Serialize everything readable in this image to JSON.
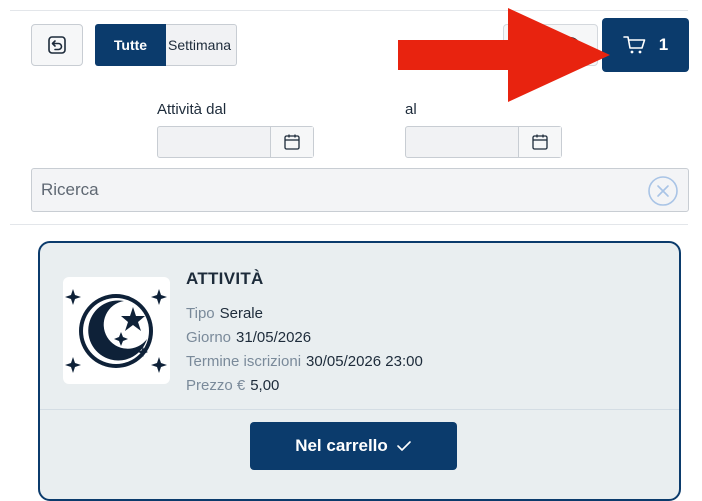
{
  "toolbar": {
    "back_icon": "back-icon",
    "segment": {
      "all_label": "Tutte",
      "week_label": "Settimana"
    },
    "cart": {
      "icon": "cart-icon",
      "count": "1"
    }
  },
  "filters": {
    "from_label": "Attività dal",
    "to_label": "al",
    "from_value": "",
    "to_value": "",
    "calendar_icon": "calendar-icon"
  },
  "search": {
    "placeholder": "Ricerca",
    "clear_icon": "clear-circle-icon"
  },
  "card": {
    "title": "ATTIVITÀ",
    "image_icon": "moon-stars-icon",
    "rows": [
      {
        "key": "Tipo",
        "value": "Serale"
      },
      {
        "key": "Giorno",
        "value": "31/05/2026"
      },
      {
        "key": "Termine iscrizioni",
        "value": "30/05/2026 23:00"
      },
      {
        "key": "Prezzo €",
        "value": "5,00"
      }
    ],
    "button_label": "Nel carrello",
    "button_icon": "check-icon"
  },
  "annotation": {
    "arrow_color": "#e8230f"
  },
  "colors": {
    "primary": "#0b3b6c",
    "card_bg": "#e9eef0",
    "label_muted": "#7a8a9a"
  }
}
